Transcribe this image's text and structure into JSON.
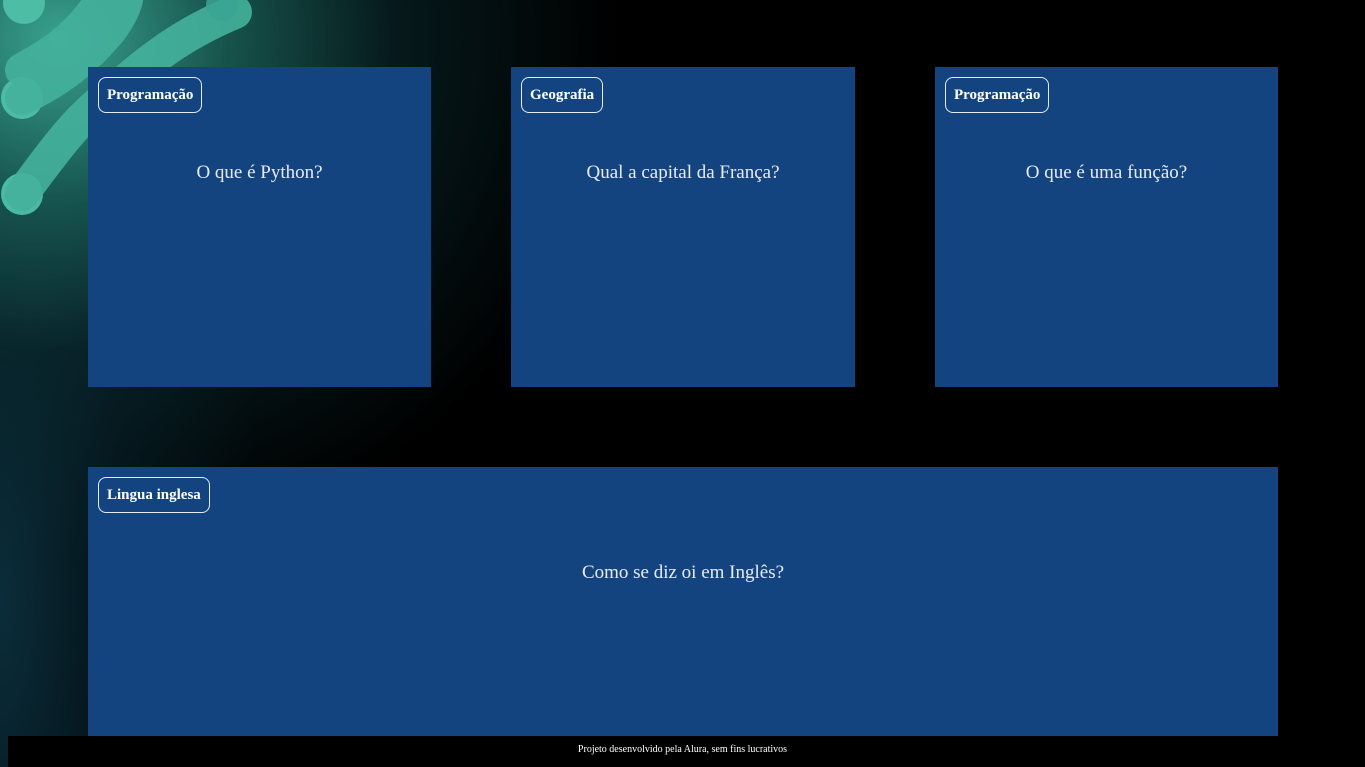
{
  "cards": [
    {
      "tag": "Programação",
      "question": "O que é Python?"
    },
    {
      "tag": "Geografia",
      "question": "Qual a capital da França?"
    },
    {
      "tag": "Programação",
      "question": "O que é uma função?"
    },
    {
      "tag": "Lingua inglesa",
      "question": "Como se diz oi em Inglês?"
    }
  ],
  "footer": {
    "text": "Projeto desenvolvido pela Alura, sem fins lucrativos"
  },
  "colors": {
    "background": "#000000",
    "card": "#144480",
    "accent_glow": "#3caa96",
    "text": "#e7ecf3"
  },
  "icons": {
    "decoration": "alura-molecule-pattern"
  }
}
